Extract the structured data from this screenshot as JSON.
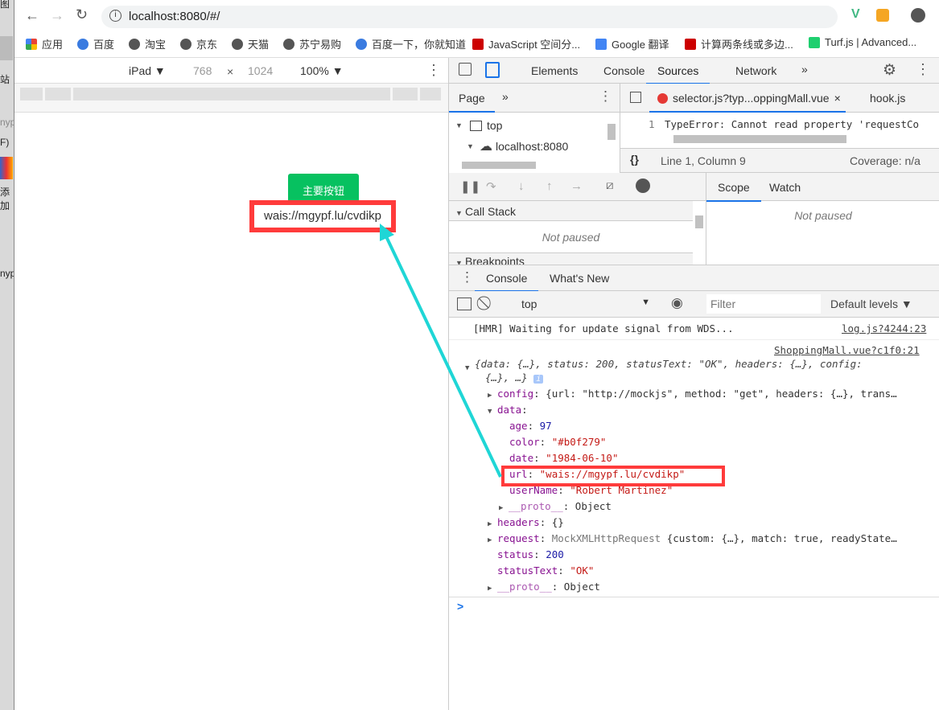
{
  "desktop": {
    "labels": [
      "图",
      "站",
      "nyp",
      "F)",
      "添加",
      "nyp"
    ]
  },
  "browser": {
    "url": "localhost:8080/#/",
    "bookmarks": [
      {
        "label": "应用",
        "icon": "apps-grid-icon"
      },
      {
        "label": "百度",
        "icon": "baidu-paw-icon"
      },
      {
        "label": "淘宝",
        "icon": "globe-icon"
      },
      {
        "label": "京东",
        "icon": "globe-icon"
      },
      {
        "label": "天猫",
        "icon": "globe-icon"
      },
      {
        "label": "苏宁易购",
        "icon": "globe-icon"
      },
      {
        "label": "百度一下，你就知道",
        "icon": "baidu-paw-icon"
      },
      {
        "label": "JavaScript 空间分...",
        "icon": "csdn-icon"
      },
      {
        "label": "Google 翻译",
        "icon": "google-translate-icon"
      },
      {
        "label": "计算两条线或多边...",
        "icon": "csdn-icon"
      },
      {
        "label": "Turf.js | Advanced...",
        "icon": "turf-icon"
      }
    ]
  },
  "device": {
    "name": "iPad ▼",
    "width": "768",
    "x": "×",
    "height": "1024",
    "zoom": "100% ▼"
  },
  "page": {
    "button": "主要按钮",
    "url_text": "wais://mgypf.lu/cvdikp",
    "button_color": "#07c160",
    "highlight_color": "#ff3b3b",
    "arrow_color": "#1fd6d6"
  },
  "devtools": {
    "tabs": [
      "Elements",
      "Console",
      "Sources",
      "Network",
      "»"
    ],
    "active_tab": "Sources",
    "nav": {
      "tab": "Page",
      "more": "»",
      "tree": [
        "top",
        "localhost:8080"
      ]
    },
    "editor": {
      "file_tab": "selector.js?typ...oppingMall.vue",
      "file_tab2": "hook.js",
      "line_no": "1",
      "code": "TypeError: Cannot read property 'requestCo",
      "status": "Line 1, Column 9",
      "coverage": "Coverage: n/a"
    },
    "debugger": {
      "call_stack": "Call Stack",
      "not_paused": "Not paused",
      "breakpoints": "Breakpoints",
      "scope": "Scope",
      "watch": "Watch",
      "scope_not_paused": "Not paused"
    },
    "drawer": {
      "tabs": [
        "Console",
        "What's New"
      ]
    },
    "console": {
      "context": "top",
      "filter_placeholder": "Filter",
      "levels": "Default levels ▼",
      "hmr": "[HMR] Waiting for update signal from WDS...",
      "hmr_src": "log.js?4244:23",
      "obj_src": "ShoppingMall.vue?c1f0:21",
      "summary1": "{data: {…}, status: 200, statusText: \"OK\", headers: {…}, config:",
      "summary2": "{…}, …}",
      "config_key": "config",
      "config_val": "{url: \"http://mockjs\", method: \"get\", headers: {…}, trans…",
      "data_key": "data",
      "fields": [
        {
          "k": "age",
          "v": "97",
          "t": "num"
        },
        {
          "k": "color",
          "v": "\"#b0f279\"",
          "t": "str"
        },
        {
          "k": "date",
          "v": "\"1984-06-10\"",
          "t": "str"
        },
        {
          "k": "url",
          "v": "\"wais://mgypf.lu/cvdikp\"",
          "t": "str"
        },
        {
          "k": "userName",
          "v": "\"Robert Martinez\"",
          "t": "str"
        }
      ],
      "proto": "__proto__",
      "object": "Object",
      "headers_key": "headers",
      "headers_val": "{}",
      "request_key": "request",
      "request_class": "MockXMLHttpRequest",
      "request_val": "{custom: {…}, match: true, readyState…",
      "status_key": "status",
      "status_val": "200",
      "statustext_key": "statusText",
      "statustext_val": "\"OK\"",
      "prompt": ">"
    }
  }
}
